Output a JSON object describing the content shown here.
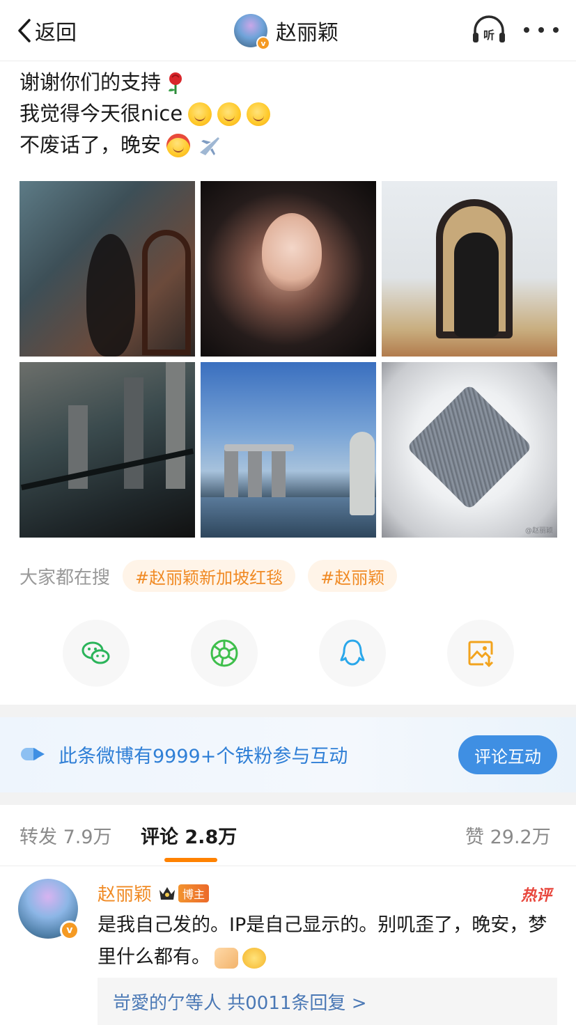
{
  "header": {
    "back_label": "返回",
    "author_name": "赵丽颖",
    "verified_badge": "v",
    "listen_label": "听"
  },
  "post": {
    "lines": [
      "谢谢你们的支持",
      "我觉得今天很nice",
      "不废话了，晚安"
    ],
    "emoji": [
      "rose",
      "smiling-face",
      "smiling-face",
      "smiling-face",
      "cake-face",
      "airplane"
    ]
  },
  "images": {
    "count": 6,
    "watermark": "@赵丽颖"
  },
  "search": {
    "label": "大家都在搜",
    "tags": [
      "#赵丽颖新加坡红毯",
      "#赵丽颖"
    ]
  },
  "share": {
    "icons": [
      "wechat-icon",
      "moments-icon",
      "qq-icon",
      "save-image-icon"
    ]
  },
  "fans_banner": {
    "text": "此条微博有9999+个铁粉参与互动",
    "button": "评论互动"
  },
  "tabs": {
    "repost": "转发 7.9万",
    "comments": "评论 2.8万",
    "likes": "赞 29.2万"
  },
  "comment": {
    "author": "赵丽颖",
    "role_badge": "博主",
    "hot_label": "热评",
    "text": "是我自己发的。IP是自己显示的。别叽歪了，晚安，梦里什么都有。",
    "replies_text": "岢愛的亇等人 共0011条回复 >"
  },
  "colors": {
    "accent_orange": "#f08a24",
    "link_blue": "#2f7fd6",
    "button_blue": "#3f8fe3",
    "tab_underline": "#ff8200"
  }
}
